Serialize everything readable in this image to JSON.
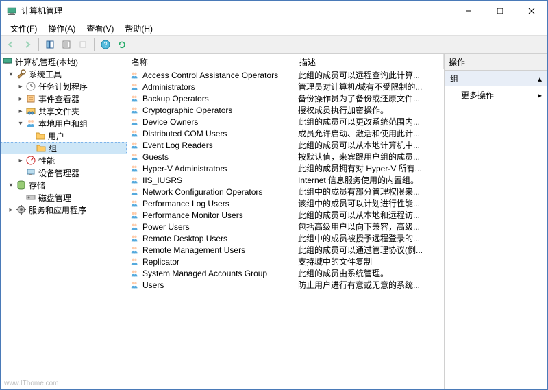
{
  "window": {
    "title": "计算机管理"
  },
  "menus": {
    "file": "文件(F)",
    "actions": "操作(A)",
    "view": "查看(V)",
    "help": "帮助(H)"
  },
  "tree": {
    "root": "计算机管理(本地)",
    "system_tools": "系统工具",
    "task_scheduler": "任务计划程序",
    "event_viewer": "事件查看器",
    "shared_folders": "共享文件夹",
    "local_users_groups": "本地用户和组",
    "users": "用户",
    "groups": "组",
    "performance": "性能",
    "device_manager": "设备管理器",
    "storage": "存储",
    "disk_management": "磁盘管理",
    "services_apps": "服务和应用程序"
  },
  "columns": {
    "name": "名称",
    "description": "描述"
  },
  "groups": [
    {
      "name": "Access Control Assistance Operators",
      "desc": "此组的成员可以远程查询此计算..."
    },
    {
      "name": "Administrators",
      "desc": "管理员对计算机/域有不受限制的..."
    },
    {
      "name": "Backup Operators",
      "desc": "备份操作员为了备份或还原文件..."
    },
    {
      "name": "Cryptographic Operators",
      "desc": "授权成员执行加密操作。"
    },
    {
      "name": "Device Owners",
      "desc": "此组的成员可以更改系统范围内..."
    },
    {
      "name": "Distributed COM Users",
      "desc": "成员允许启动、激活和使用此计..."
    },
    {
      "name": "Event Log Readers",
      "desc": "此组的成员可以从本地计算机中..."
    },
    {
      "name": "Guests",
      "desc": "按默认值，来宾跟用户组的成员..."
    },
    {
      "name": "Hyper-V Administrators",
      "desc": "此组的成员拥有对 Hyper-V 所有..."
    },
    {
      "name": "IIS_IUSRS",
      "desc": "Internet 信息服务使用的内置组。"
    },
    {
      "name": "Network Configuration Operators",
      "desc": "此组中的成员有部分管理权限来..."
    },
    {
      "name": "Performance Log Users",
      "desc": "该组中的成员可以计划进行性能..."
    },
    {
      "name": "Performance Monitor Users",
      "desc": "此组的成员可以从本地和远程访..."
    },
    {
      "name": "Power Users",
      "desc": "包括高级用户以向下兼容，高级..."
    },
    {
      "name": "Remote Desktop Users",
      "desc": "此组中的成员被授予远程登录的..."
    },
    {
      "name": "Remote Management Users",
      "desc": "此组的成员可以通过管理协议(例..."
    },
    {
      "name": "Replicator",
      "desc": "支持域中的文件复制"
    },
    {
      "name": "System Managed Accounts Group",
      "desc": "此组的成员由系统管理。"
    },
    {
      "name": "Users",
      "desc": "防止用户进行有意或无意的系统..."
    }
  ],
  "actions": {
    "header": "操作",
    "group_label": "组",
    "more_actions": "更多操作"
  },
  "watermark": "www.IThome.com"
}
